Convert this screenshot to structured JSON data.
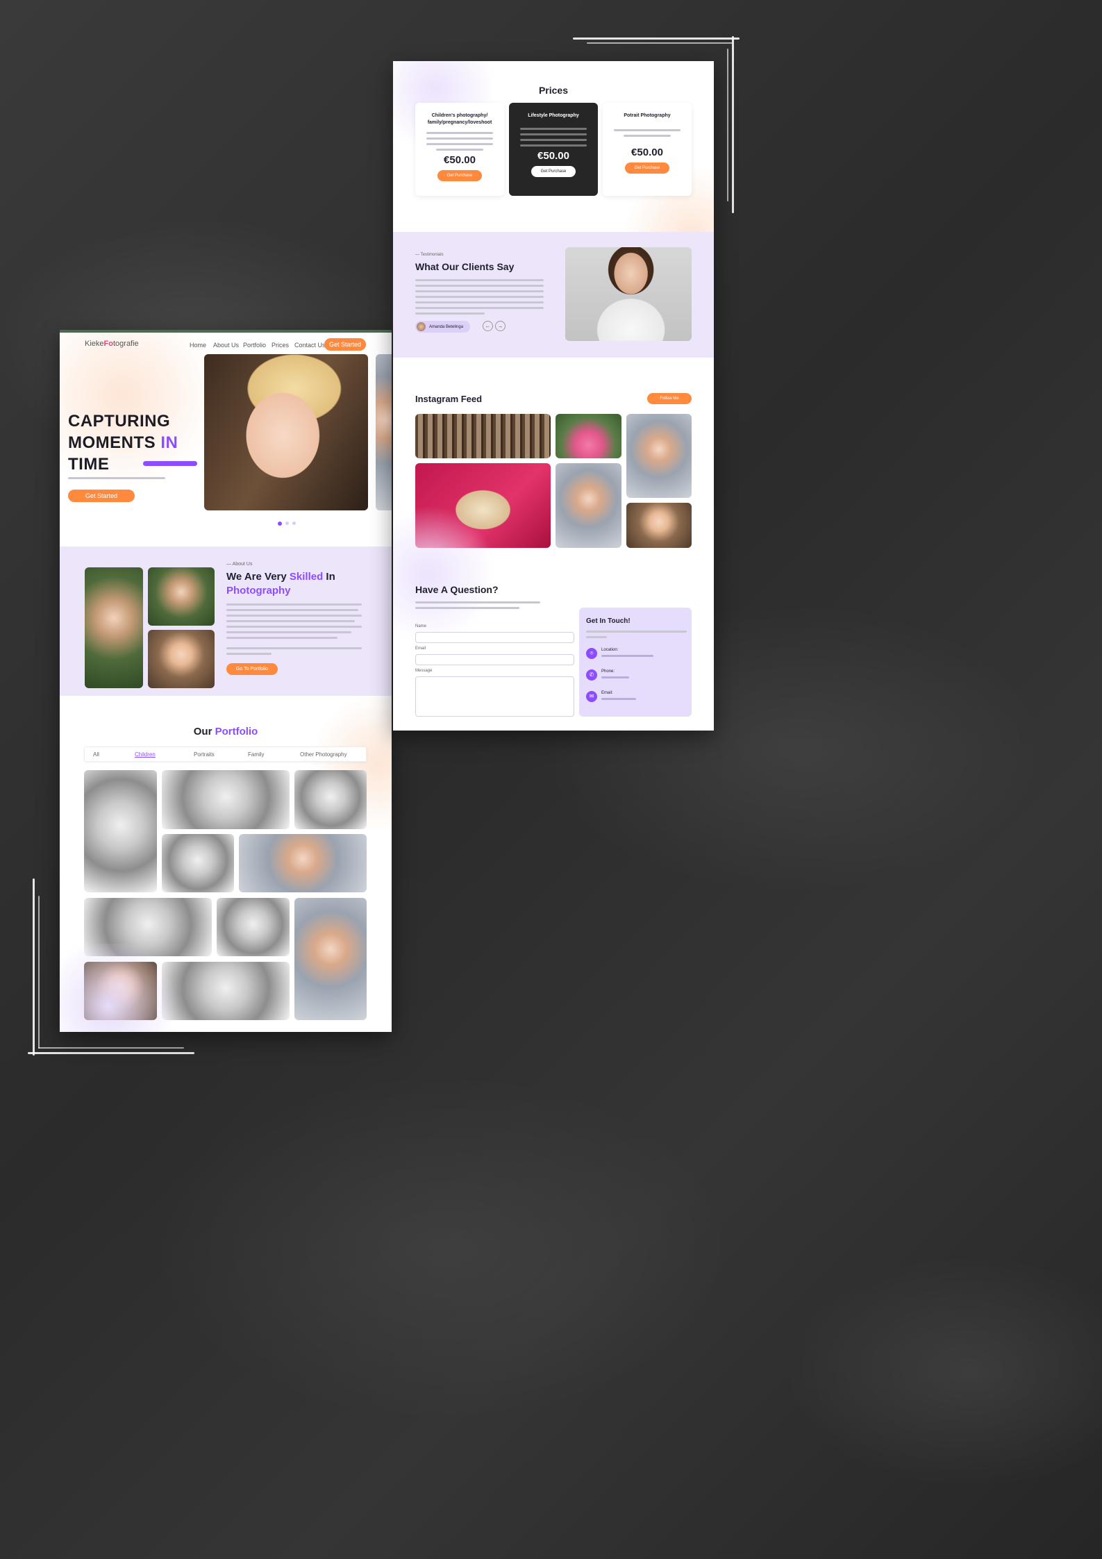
{
  "left_page": {
    "header": {
      "logo_prefix": "Kieke",
      "logo_accent": "Fo",
      "logo_suffix": "tografie",
      "nav": [
        "Home",
        "About Us",
        "Portfolio",
        "Prices",
        "Contact Us"
      ],
      "cta": "Get Started"
    },
    "hero": {
      "line1": "CAPTURING",
      "line2_a": "MOMENTS",
      "line2_b": "IN",
      "line3": "TIME",
      "cta": "Get Started"
    },
    "about": {
      "eyebrow": "About Us",
      "title_a": "We Are Very",
      "title_b": "Skilled",
      "title_c": "In",
      "title_d": "Photography",
      "cta": "Go To Portfolio"
    },
    "portfolio": {
      "title_a": "Our",
      "title_b": "Portfolio",
      "tabs": [
        "All",
        "Children",
        "Portraits",
        "Family",
        "Other Photography"
      ],
      "active_tab": "Children"
    }
  },
  "right_page": {
    "prices": {
      "title": "Prices",
      "cards": [
        {
          "title": "Children's photography/ family/pregnancy/loveshoot",
          "price": "€50.00",
          "cta": "Get Purchase",
          "dark": false
        },
        {
          "title": "Lifestyle Photography",
          "price": "€50.00",
          "cta": "Get Purchase",
          "dark": true
        },
        {
          "title": "Potrait Photography",
          "price": "€50.00",
          "cta": "Get Purchase",
          "dark": false
        }
      ]
    },
    "testimonials": {
      "eyebrow": "Testimonials",
      "title": "What Our Clients Say",
      "author": "Amanda Betelinga"
    },
    "instagram": {
      "title": "Instagram Feed",
      "cta": "Follow Me"
    },
    "contact": {
      "title": "Have A Question?",
      "labels": [
        "Name",
        "Email",
        "Message"
      ],
      "card_title": "Get In Touch!",
      "items": [
        {
          "label": "Location:",
          "icon": "location-icon"
        },
        {
          "label": "Phone:",
          "icon": "phone-icon"
        },
        {
          "label": "Email:",
          "icon": "email-icon"
        }
      ]
    }
  },
  "colors": {
    "accent_purple": "#8b4dff",
    "accent_orange": "#ff8a3d",
    "lavender": "#ede6fb",
    "dark_card": "#262626",
    "background": "#2f2f2f"
  }
}
